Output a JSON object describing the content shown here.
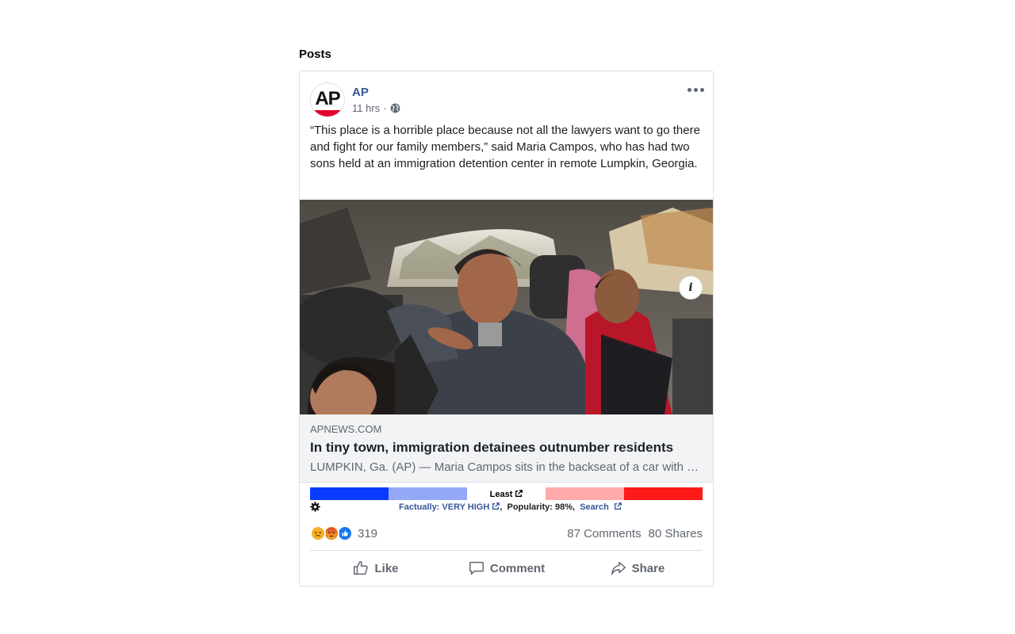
{
  "section": {
    "title": "Posts"
  },
  "post": {
    "page_name": "AP",
    "avatar_text": "AP",
    "time": "11 hrs",
    "separator": "·",
    "text": "“This place is a horrible place because not all the lawyers want to go there and fight for our family members,” said Maria Campos, who has had two sons held at an immigration detention center in remote Lumpkin, Georgia.",
    "link": {
      "domain": "APNEWS.COM",
      "title": "In tiny town, immigration detainees outnumber residents",
      "description": "LUMPKIN, Ga. (AP) — Maria Campos sits in the backseat of a car with her grandchildren outside the detention center."
    },
    "bias": {
      "label": "Least",
      "colors": [
        "#0a3cff",
        "#95a8f8",
        "#ffffff",
        "#ffaaaa",
        "#ff1a1a"
      ],
      "factually_prefix": "Factually: ",
      "factually_value": "VERY HIGH",
      "popularity": "Popularity: 98%,",
      "search": "Search"
    },
    "reactions": {
      "icons": [
        "sad-emoji",
        "angry-emoji",
        "like-emoji"
      ],
      "count": "319"
    },
    "comments": "87 Comments",
    "shares": "80 Shares",
    "actions": {
      "like": "Like",
      "comment": "Comment",
      "share": "Share"
    }
  }
}
